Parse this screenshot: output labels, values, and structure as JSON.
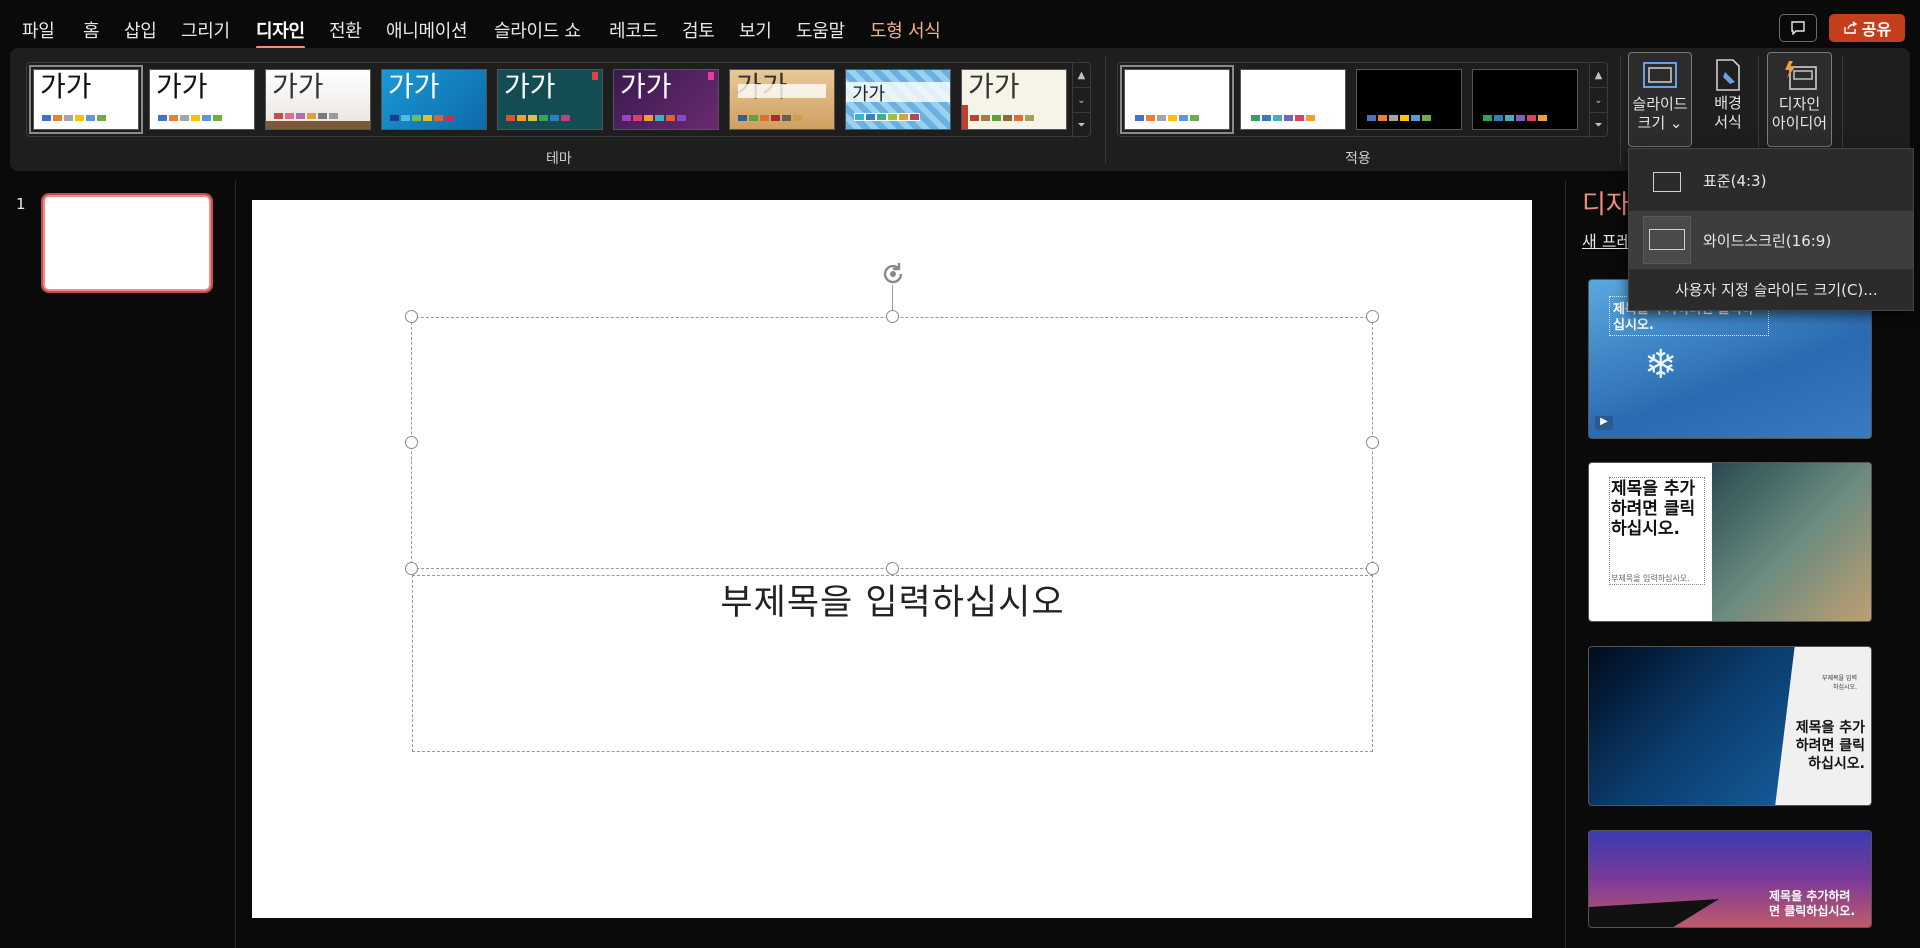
{
  "menu": {
    "tabs": [
      "파일",
      "홈",
      "삽입",
      "그리기",
      "디자인",
      "전환",
      "애니메이션",
      "슬라이드 쇼",
      "레코드",
      "검토",
      "보기",
      "도움말",
      "도형 서식"
    ],
    "share_label": "공유"
  },
  "ribbon": {
    "themes_group_label": "테마",
    "variants_group_label": "적용",
    "theme_sample_text": "가가",
    "slide_size_label_line1": "슬라이드",
    "slide_size_label_line2": "크기",
    "background_label_line1": "배경",
    "background_label_line2": "서식",
    "designer_label_line1": "디자인",
    "designer_label_line2": "아이디어"
  },
  "slide_size_menu": {
    "standard": "표준(4:3)",
    "widescreen": "와이드스크린(16:9)",
    "custom": "사용자 지정 슬라이드 크기(C)..."
  },
  "thumbnails": {
    "slide_number": "1"
  },
  "slide": {
    "subtitle_placeholder": "부제목을 입력하십시오"
  },
  "designer": {
    "title": "디자",
    "new_link": "새 프레",
    "card1_title": "제목을 추가하려면 클릭하십시오.",
    "card2_title": "제목을 추가하려면 클릭하십시오.",
    "card2_sub": "부제목을 입력하십시오.",
    "card3_title": "제목을 추가하려면 클릭하십시오.",
    "card3_sub": "부제목을 입력하십시오.",
    "card4_title": "제목을 추가하려면 클릭하십시오."
  },
  "colors": {
    "accent": "#f28b82",
    "share": "#c43e1c",
    "ribbon_bg": "#1e1e1e",
    "app_bg": "#0a0a0a"
  }
}
